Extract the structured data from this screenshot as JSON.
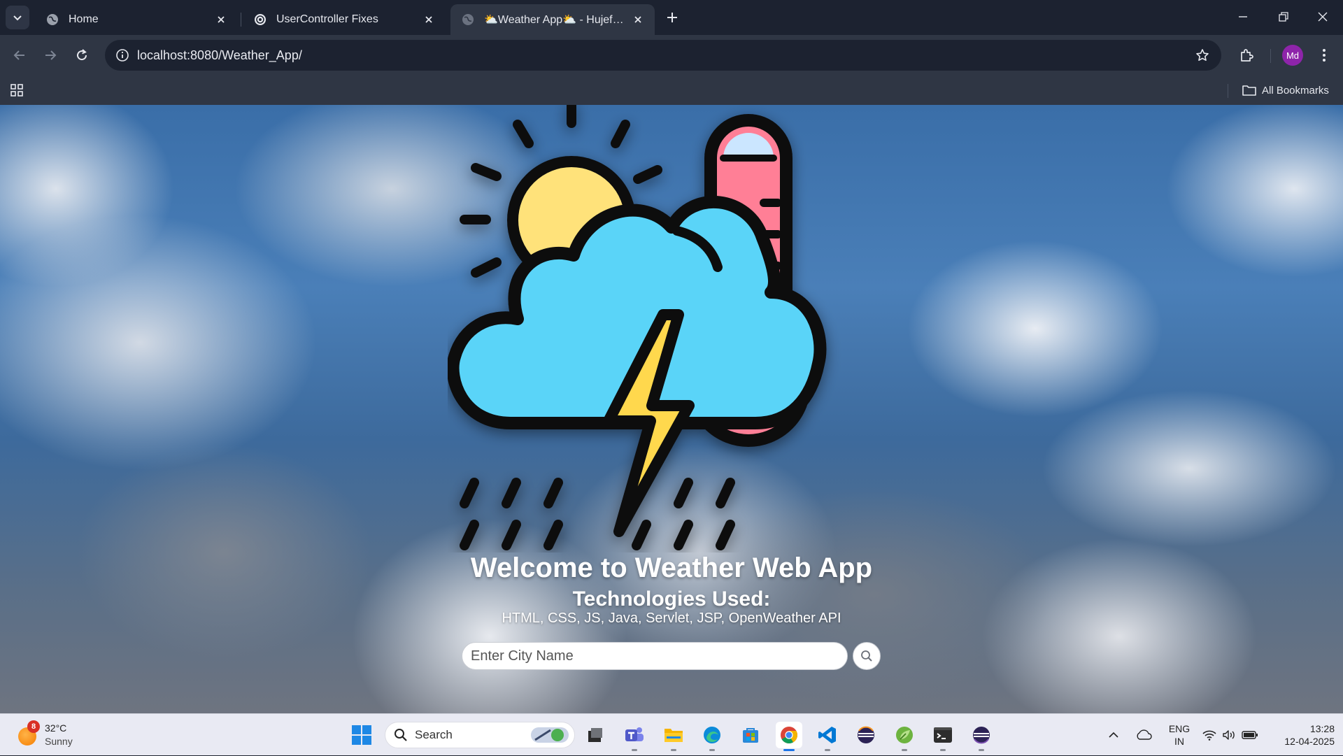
{
  "browser": {
    "tabs": [
      {
        "title": "Home",
        "active": false
      },
      {
        "title": "UserController Fixes",
        "active": false
      },
      {
        "title": "⛅Weather App⛅ - Hujefa Sa",
        "active": true
      }
    ],
    "url": "localhost:8080/Weather_App/",
    "profile_initials": "Md",
    "all_bookmarks_label": "All Bookmarks"
  },
  "page": {
    "welcome": "Welcome to Weather Web App",
    "tech_title": "Technologies Used:",
    "tech_list": "HTML, CSS, JS, Java, Servlet, JSP, OpenWeather API",
    "search": {
      "placeholder": "Enter City Name",
      "value": ""
    }
  },
  "taskbar": {
    "weather": {
      "temp": "32°C",
      "condition": "Sunny",
      "badge": "8"
    },
    "search_label": "Search",
    "apps": [
      "task-view-icon",
      "teams-icon",
      "file-explorer-icon",
      "edge-icon",
      "store-icon",
      "chrome-icon",
      "vscode-icon",
      "eclipse-icon",
      "spring-tools-icon",
      "terminal-icon",
      "eclipse-jee-icon"
    ],
    "active_app": "chrome-icon",
    "language": {
      "line1": "ENG",
      "line2": "IN"
    },
    "time": "13:28",
    "date": "12-04-2025"
  },
  "colors": {
    "browser_frame": "#1c2230",
    "toolbar": "#2f3644",
    "sky_blue": "#3a6ea8",
    "cloud_icon": "#5ad4f8",
    "thermometer": "#ff7f96",
    "bolt": "#ffd84d",
    "sun": "#ffe27a"
  }
}
